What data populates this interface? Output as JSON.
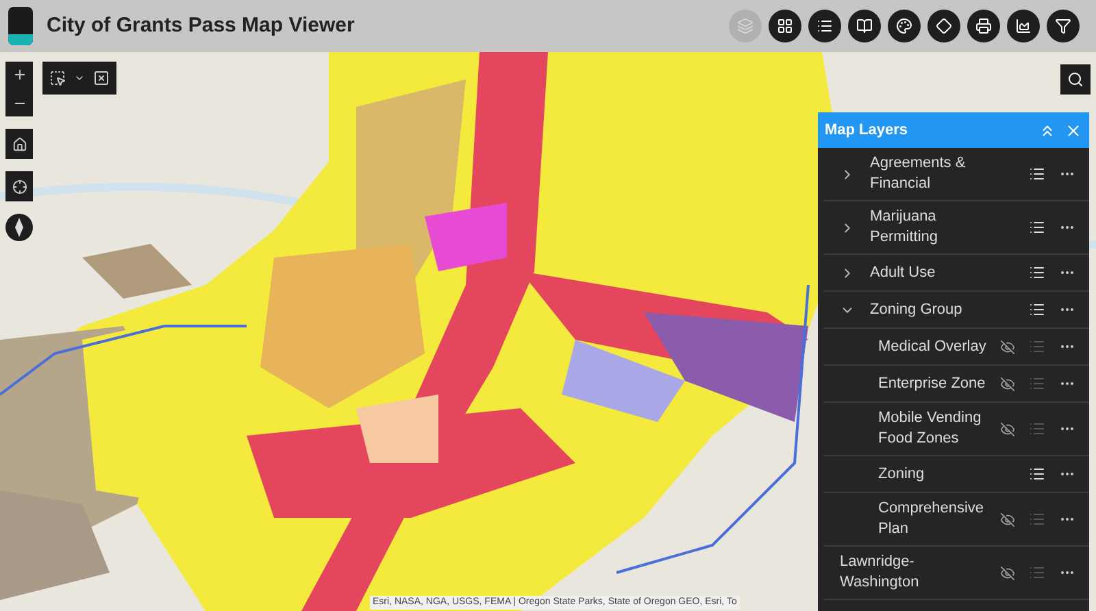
{
  "header": {
    "title": "City of Grants Pass Map Viewer"
  },
  "toolbar": [
    {
      "selected": true
    },
    {
      "selected": false
    },
    {
      "selected": false
    },
    {
      "selected": false
    },
    {
      "selected": false
    },
    {
      "selected": false
    },
    {
      "selected": false
    },
    {
      "selected": false
    },
    {
      "selected": false
    }
  ],
  "attribution": "Esri, NASA, NGA, USGS, FEMA | Oregon State Parks, State of Oregon GEO, Esri, To",
  "layers_panel": {
    "title": "Map Layers",
    "items": [
      {
        "label": "Agreements & Financial",
        "kind": "group",
        "expanded": false,
        "visible": true
      },
      {
        "label": "Marijuana Permitting",
        "kind": "group",
        "expanded": false,
        "visible": true
      },
      {
        "label": "Adult Use",
        "kind": "group",
        "expanded": false,
        "visible": true
      },
      {
        "label": "Zoning Group",
        "kind": "group",
        "expanded": true,
        "visible": true,
        "children": [
          {
            "label": "Medical Overlay",
            "visible": false
          },
          {
            "label": "Enterprise Zone",
            "visible": false
          },
          {
            "label": "Mobile Vending Food Zones",
            "visible": false
          },
          {
            "label": "Zoning",
            "visible": true
          },
          {
            "label": "Comprehensive Plan",
            "visible": false
          }
        ]
      },
      {
        "label": "Lawnridge-Washington",
        "kind": "layer",
        "visible": false
      }
    ]
  }
}
